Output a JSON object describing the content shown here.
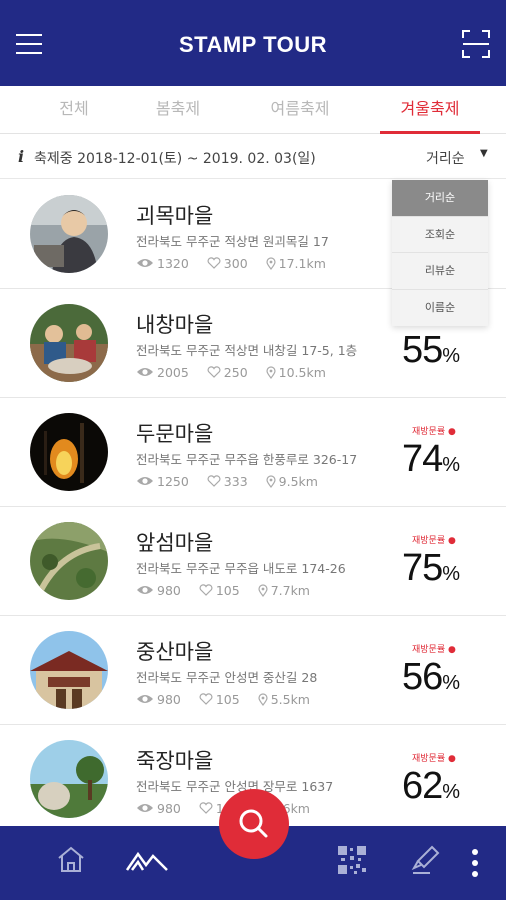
{
  "header": {
    "title": "STAMP TOUR"
  },
  "tabs": [
    {
      "label": "전체",
      "active": false
    },
    {
      "label": "봄축제",
      "active": false
    },
    {
      "label": "여름축제",
      "active": false
    },
    {
      "label": "겨울축제",
      "active": true
    }
  ],
  "info": {
    "period": "축제중 2018-12-01(토) ~ 2019. 02. 03(일)",
    "sort_selected": "거리순"
  },
  "sort_options": [
    "거리순",
    "조회순",
    "리뷰순",
    "이름순"
  ],
  "progress_label": "재방문률",
  "villages": [
    {
      "name": "괴목마을",
      "address": "전라북도 무주군 적상면 원괴목길 17",
      "views": "1320",
      "likes": "300",
      "distance": "17.1km",
      "progress": "",
      "unit": ""
    },
    {
      "name": "내창마을",
      "address": "전라북도 무주군 적상면 내창길 17-5, 1층",
      "views": "2005",
      "likes": "250",
      "distance": "10.5km",
      "progress": "55",
      "unit": "%"
    },
    {
      "name": "두문마을",
      "address": "전라북도 무주군 무주읍 한풍루로 326-17",
      "views": "1250",
      "likes": "333",
      "distance": "9.5km",
      "progress": "74",
      "unit": "%"
    },
    {
      "name": "앞섬마을",
      "address": "전라북도 무주군 무주읍 내도로 174-26",
      "views": "980",
      "likes": "105",
      "distance": "7.7km",
      "progress": "75",
      "unit": "%"
    },
    {
      "name": "중산마을",
      "address": "전라북도 무주군 안성면 중산길 28",
      "views": "980",
      "likes": "105",
      "distance": "5.5km",
      "progress": "56",
      "unit": "%"
    },
    {
      "name": "죽장마을",
      "address": "전라북도 무주군 안성면 장무로 1637",
      "views": "980",
      "likes": "105",
      "distance": "5.6km",
      "progress": "62",
      "unit": "%"
    }
  ],
  "colors": {
    "brand": "#222a86",
    "accent": "#e02c38"
  },
  "icons": [
    "menu-icon",
    "qr-scan-icon",
    "info-icon",
    "eye-icon",
    "heart-icon",
    "location-pin-icon",
    "home-icon",
    "mountain-icon",
    "search-icon",
    "qr-code-icon",
    "stamp-me-icon",
    "more-vert-icon"
  ]
}
